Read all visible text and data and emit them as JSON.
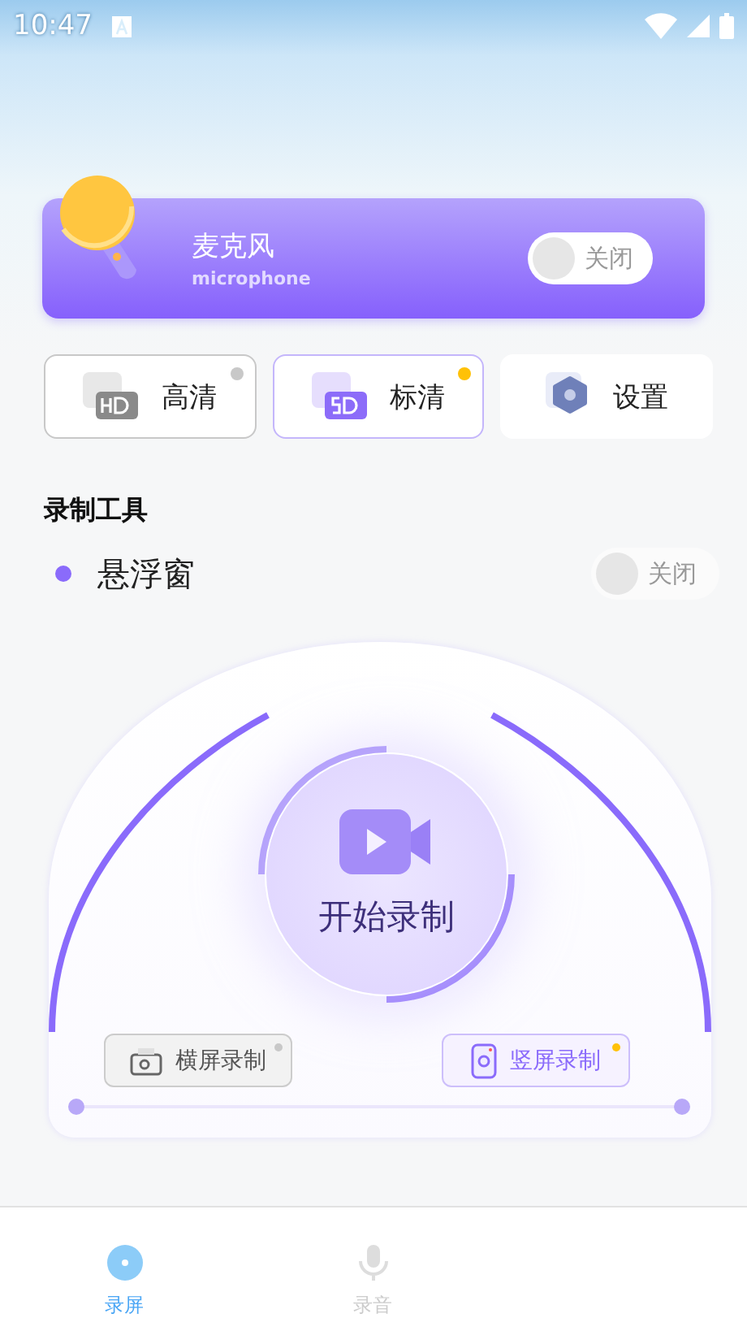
{
  "status_bar": {
    "time": "10:47"
  },
  "mic_card": {
    "title": "麦克风",
    "subtitle": "microphone",
    "toggle": {
      "on": false,
      "label": "关闭"
    }
  },
  "quality_buttons": [
    {
      "kind": "hd",
      "label": "高清",
      "selected": false
    },
    {
      "kind": "sd",
      "label": "标清",
      "selected": true
    },
    {
      "kind": "settings",
      "label": "设置",
      "selected": false
    }
  ],
  "section_title": "录制工具",
  "floating_window": {
    "label": "悬浮窗",
    "toggle": {
      "on": false,
      "label": "关闭"
    }
  },
  "record_button": {
    "label": "开始录制"
  },
  "orientation_buttons": [
    {
      "kind": "landscape",
      "label": "横屏录制",
      "selected": false
    },
    {
      "kind": "portrait",
      "label": "竖屏录制",
      "selected": true
    }
  ],
  "bottom_nav": [
    {
      "kind": "screen",
      "label": "录屏",
      "selected": true
    },
    {
      "kind": "audio",
      "label": "录音",
      "selected": false
    }
  ]
}
